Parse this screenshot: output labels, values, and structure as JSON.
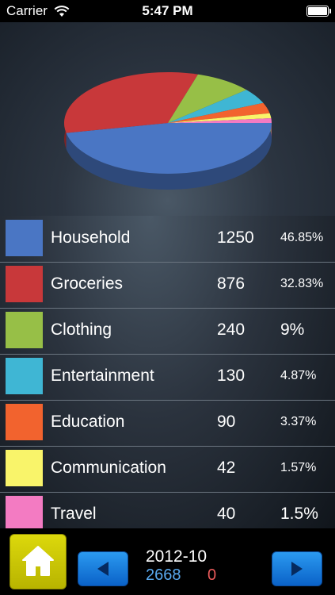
{
  "status_bar": {
    "carrier": "Carrier",
    "time": "5:47 PM"
  },
  "chart_data": {
    "type": "pie",
    "categories": [
      "Household",
      "Groceries",
      "Clothing",
      "Entertainment",
      "Education",
      "Communication",
      "Travel"
    ],
    "values": [
      1250,
      876,
      240,
      130,
      90,
      42,
      40
    ],
    "colors": [
      "#4a76c4",
      "#c8383a",
      "#97bf47",
      "#3fb6d4",
      "#f2632e",
      "#f9f46a",
      "#f37bc2"
    ]
  },
  "categories": [
    {
      "name": "Household",
      "amount": "1250",
      "percent": "46.85%",
      "color": "#4a76c4"
    },
    {
      "name": "Groceries",
      "amount": "876",
      "percent": "32.83%",
      "color": "#c8383a"
    },
    {
      "name": "Clothing",
      "amount": "240",
      "percent": "9%",
      "color": "#97bf47"
    },
    {
      "name": "Entertainment",
      "amount": "130",
      "percent": "4.87%",
      "color": "#3fb6d4"
    },
    {
      "name": "Education",
      "amount": "90",
      "percent": "3.37%",
      "color": "#f2632e"
    },
    {
      "name": "Communication",
      "amount": "42",
      "percent": "1.57%",
      "color": "#f9f46a"
    },
    {
      "name": "Travel",
      "amount": "40",
      "percent": "1.5%",
      "color": "#f37bc2"
    }
  ],
  "footer": {
    "period": "2012-10",
    "total": "2668",
    "other": "0"
  },
  "icons": {
    "home": "home-icon",
    "prev": "arrow-left-icon",
    "next": "arrow-right-icon"
  }
}
